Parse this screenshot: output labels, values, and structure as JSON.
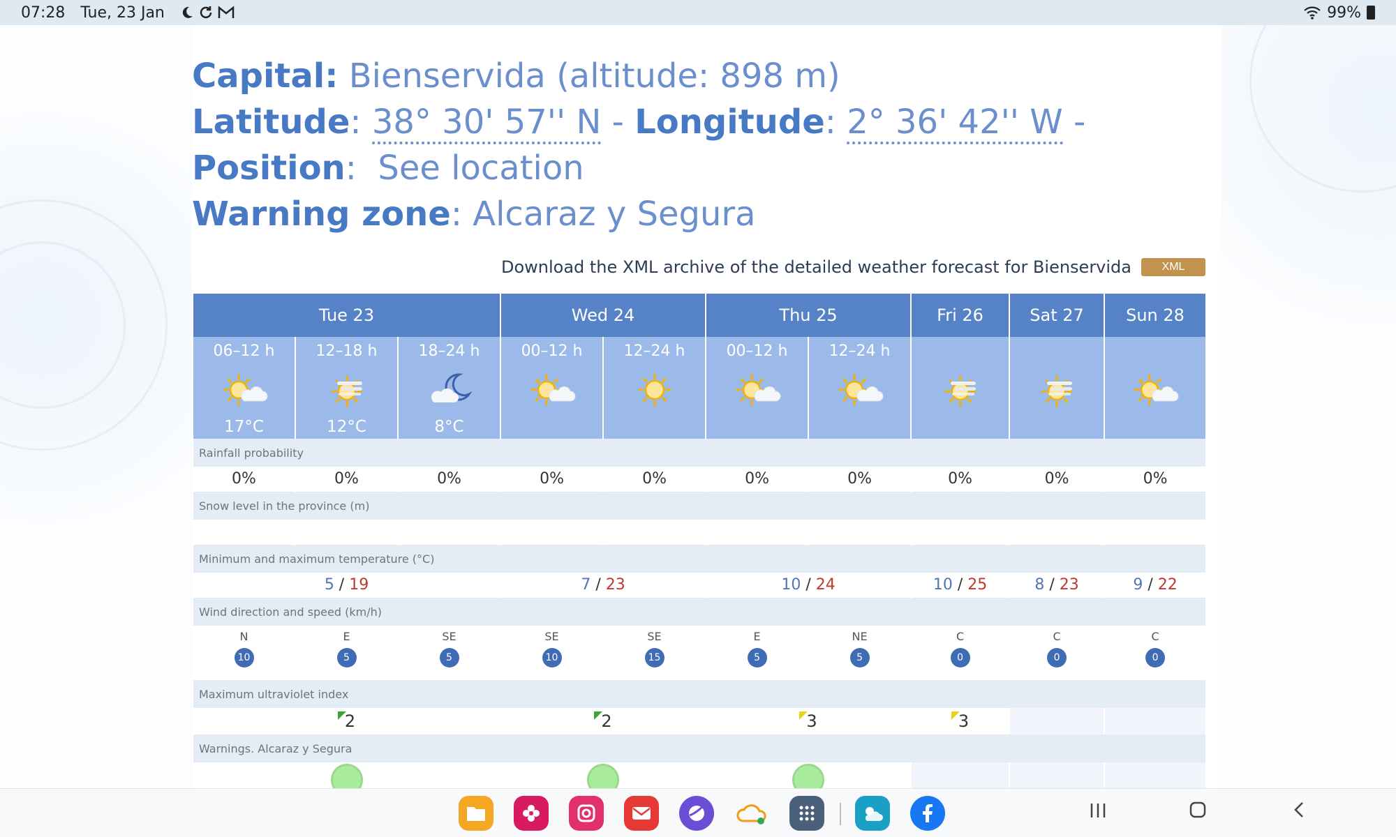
{
  "status": {
    "time": "07:28",
    "date": "Tue, 23 Jan",
    "battery": "99%",
    "icons": [
      "moon-icon",
      "sync-icon",
      "gmail-icon",
      "wifi-icon",
      "battery-icon"
    ]
  },
  "header": {
    "capital_label": "Capital:",
    "capital_value": "Bienservida (altitude: 898 m)",
    "latitude_label": "Latitude",
    "latitude_value": "38° 30' 57'' N",
    "longitude_label": "Longitude",
    "longitude_value": "2° 36' 42'' W",
    "position_label": "Position",
    "position_value": "See location",
    "warning_label": "Warning zone",
    "warning_value": "Alcaraz y Segura"
  },
  "xml": {
    "text": "Download the XML archive of the detailed weather forecast for Bienservida",
    "button": "XML"
  },
  "days": [
    "Tue 23",
    "Wed 24",
    "Thu 25",
    "Fri 26",
    "Sat 27",
    "Sun 28"
  ],
  "periods": [
    {
      "label": "06–12 h",
      "icon": "sun-cloud-icon",
      "temp": "17°C"
    },
    {
      "label": "12–18 h",
      "icon": "sun-haze-icon",
      "temp": "12°C"
    },
    {
      "label": "18–24 h",
      "icon": "moon-cloud-icon",
      "temp": "8°C"
    },
    {
      "label": "00–12 h",
      "icon": "sun-cloud-icon",
      "temp": ""
    },
    {
      "label": "12–24 h",
      "icon": "sun-icon",
      "temp": ""
    },
    {
      "label": "00–12 h",
      "icon": "sun-cloud-icon",
      "temp": ""
    },
    {
      "label": "12–24 h",
      "icon": "sun-cloud-icon",
      "temp": ""
    },
    {
      "label": "",
      "icon": "sun-haze-icon",
      "temp": ""
    },
    {
      "label": "",
      "icon": "sun-haze-icon",
      "temp": ""
    },
    {
      "label": "",
      "icon": "sun-cloud-icon",
      "temp": ""
    }
  ],
  "sections": {
    "rain": "Rainfall probability",
    "snow": "Snow level in the province (m)",
    "temp": "Minimum and maximum temperature (°C)",
    "wind": "Wind direction and speed (km/h)",
    "uv": "Maximum ultraviolet index",
    "warnings": "Warnings. Alcaraz y Segura"
  },
  "rain": [
    "0%",
    "0%",
    "0%",
    "0%",
    "0%",
    "0%",
    "0%",
    "0%",
    "0%",
    "0%"
  ],
  "temps": [
    {
      "min": "5",
      "max": "19"
    },
    {
      "min": "7",
      "max": "23"
    },
    {
      "min": "10",
      "max": "24"
    },
    {
      "min": "10",
      "max": "25"
    },
    {
      "min": "8",
      "max": "23"
    },
    {
      "min": "9",
      "max": "22"
    }
  ],
  "wind": [
    {
      "dir": "N",
      "speed": "10"
    },
    {
      "dir": "E",
      "speed": "5"
    },
    {
      "dir": "SE",
      "speed": "5"
    },
    {
      "dir": "SE",
      "speed": "10"
    },
    {
      "dir": "SE",
      "speed": "15"
    },
    {
      "dir": "E",
      "speed": "5"
    },
    {
      "dir": "NE",
      "speed": "5"
    },
    {
      "dir": "C",
      "speed": "0"
    },
    {
      "dir": "C",
      "speed": "0"
    },
    {
      "dir": "C",
      "speed": "0"
    }
  ],
  "uv": [
    {
      "value": "2",
      "level_color": "#3aa635"
    },
    {
      "value": "2",
      "level_color": "#3aa635"
    },
    {
      "value": "3",
      "level_color": "#e7d31c"
    },
    {
      "value": "3",
      "level_color": "#e7d31c"
    }
  ],
  "dock": [
    "files-app-icon",
    "gallery-app-icon",
    "instagram-app-icon",
    "email-app-icon",
    "internet-app-icon",
    "cloud-app-icon",
    "apps-grid-icon",
    "weather-app-icon",
    "facebook-app-icon"
  ],
  "colors": {
    "header_blue": "#4879c4",
    "day_header": "#5683c7",
    "period_bg": "#9bbaea",
    "section_bg": "#e4edf5",
    "max_temp": "#c0392b",
    "min_temp": "#5076b8"
  }
}
